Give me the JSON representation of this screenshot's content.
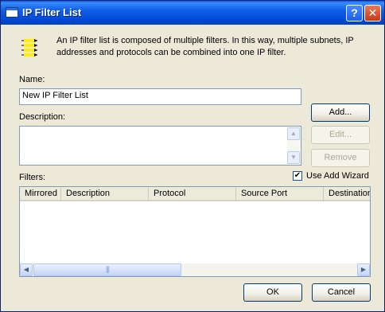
{
  "window": {
    "title": "IP Filter List",
    "help_button": "?",
    "close_button": "✕"
  },
  "intro": {
    "text": "An IP filter list is composed of multiple filters. In this way, multiple subnets, IP addresses and protocols can be combined into one IP filter."
  },
  "name_field": {
    "label": "Name:",
    "value": "New IP Filter List"
  },
  "description_field": {
    "label": "Description:",
    "value": ""
  },
  "side_buttons": {
    "add": "Add...",
    "edit": "Edit...",
    "remove": "Remove"
  },
  "filters": {
    "label": "Filters:",
    "use_add_wizard": "Use Add Wizard",
    "use_add_wizard_checked": true,
    "columns": [
      "Mirrored",
      "Description",
      "Protocol",
      "Source Port",
      "Destination"
    ],
    "rows": []
  },
  "footer": {
    "ok": "OK",
    "cancel": "Cancel"
  }
}
